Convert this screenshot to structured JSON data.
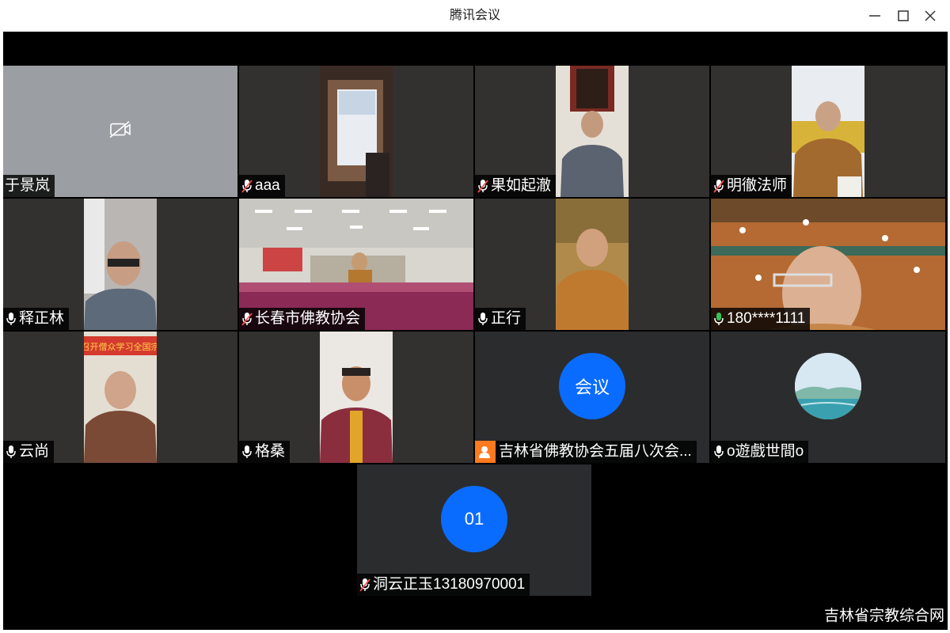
{
  "window": {
    "title": "腾讯会议"
  },
  "participants": [
    {
      "name": "于景岚",
      "mic": "none"
    },
    {
      "name": "aaa",
      "mic": "muted"
    },
    {
      "name": "果如起澈",
      "mic": "muted"
    },
    {
      "name": "明徹法师",
      "mic": "muted"
    },
    {
      "name": "释正林",
      "mic": "on"
    },
    {
      "name": "长春市佛教协会",
      "mic": "muted"
    },
    {
      "name": "正行",
      "mic": "on"
    },
    {
      "name": "180****1111",
      "mic": "speaking"
    },
    {
      "name": "云尚",
      "mic": "on"
    },
    {
      "name": "格桑",
      "mic": "on"
    },
    {
      "name": "吉林省佛教协会五届八次会...",
      "mic": "org",
      "avatar_text": "会议"
    },
    {
      "name": "o遊戲世間o",
      "mic": "on"
    },
    {
      "name": "洞云正玉13180970001",
      "mic": "muted",
      "avatar_text": "01"
    }
  ],
  "banner": {
    "text": "召开僧众学习全国宗"
  },
  "watermark": "吉林省宗教综合网",
  "colors": {
    "accent": "#0a6cff",
    "speaking": "#39c15a",
    "org_icon": "#ff7a1f"
  }
}
